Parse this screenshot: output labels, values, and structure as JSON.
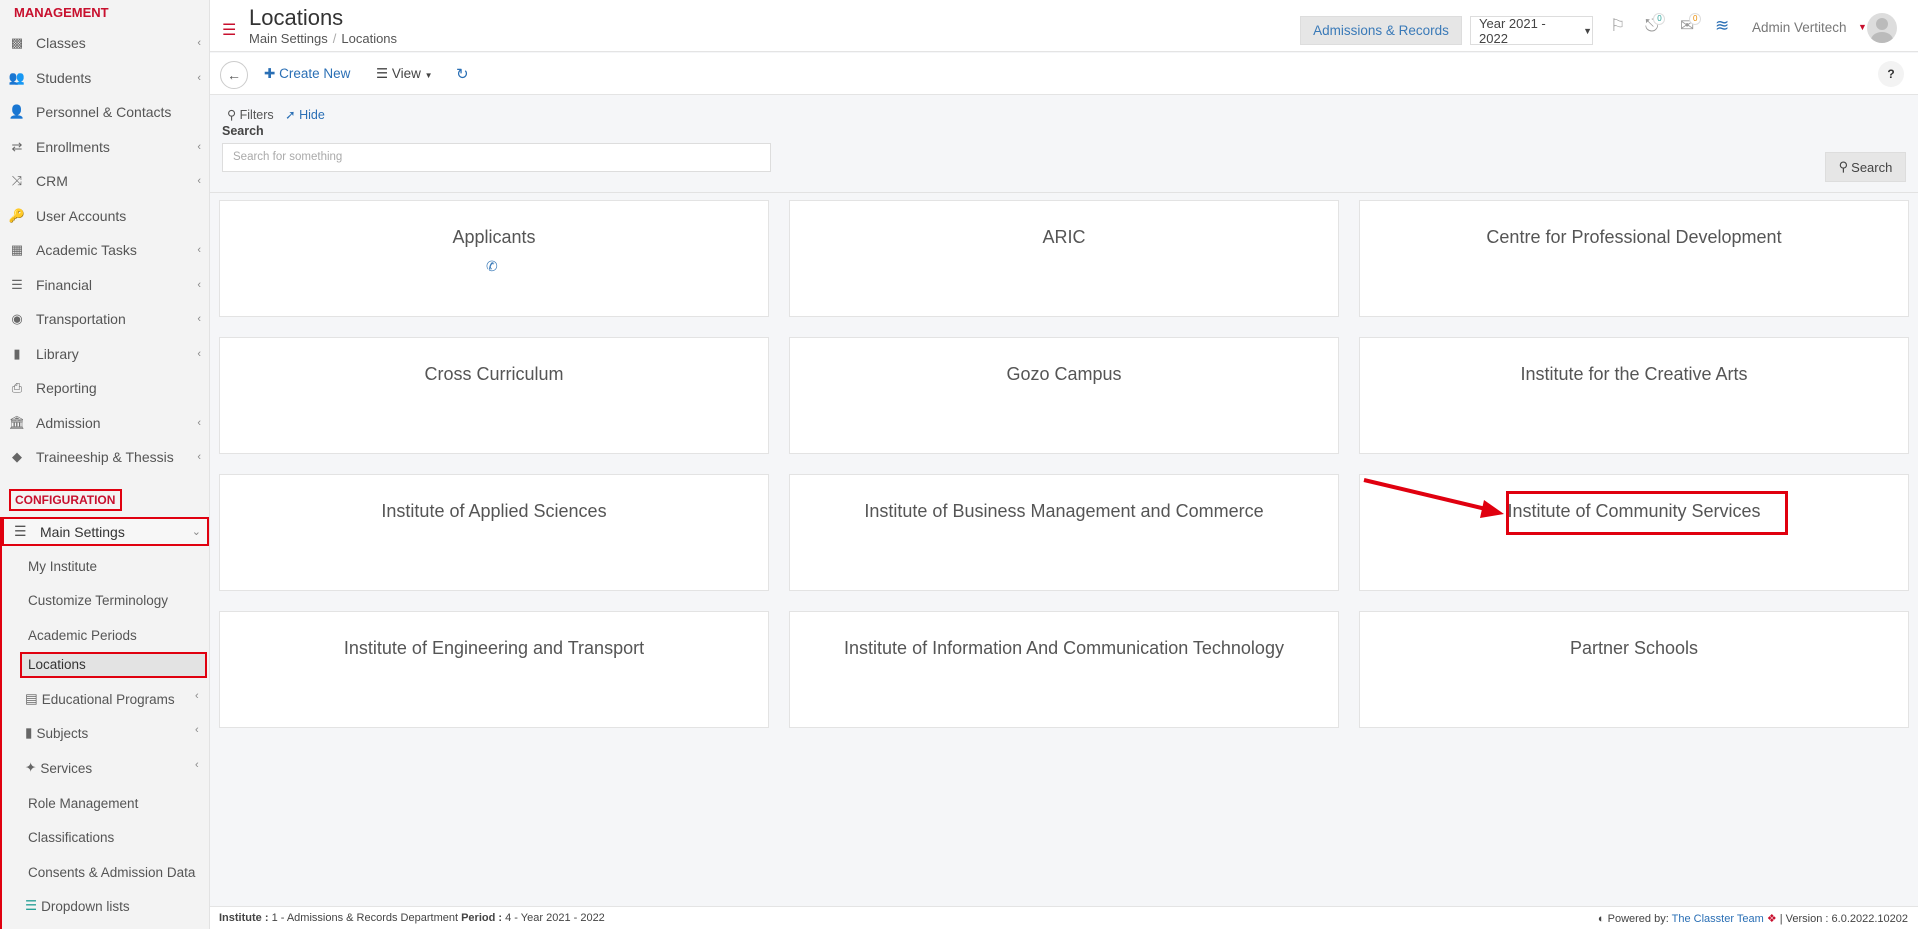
{
  "sidebar": {
    "management_header": "MANAGEMENT",
    "items": [
      {
        "label": "Classes",
        "icon": "classes-icon"
      },
      {
        "label": "Students",
        "icon": "students-icon"
      },
      {
        "label": "Personnel & Contacts",
        "icon": "personnel-icon"
      },
      {
        "label": "Enrollments",
        "icon": "enrollments-icon"
      },
      {
        "label": "CRM",
        "icon": "crm-icon"
      },
      {
        "label": "User Accounts",
        "icon": "key-icon"
      },
      {
        "label": "Academic Tasks",
        "icon": "grid-icon"
      },
      {
        "label": "Financial",
        "icon": "coins-icon"
      },
      {
        "label": "Transportation",
        "icon": "bus-icon"
      },
      {
        "label": "Library",
        "icon": "books-icon"
      },
      {
        "label": "Reporting",
        "icon": "printer-icon"
      },
      {
        "label": "Admission",
        "icon": "institution-icon"
      },
      {
        "label": "Traineeship & Thessis",
        "icon": "cube-icon"
      }
    ],
    "configuration_header": "CONFIGURATION",
    "main_settings": "Main Settings",
    "sub_items": {
      "my_institute": "My Institute",
      "customize_terminology": "Customize Terminology",
      "academic_periods": "Academic Periods",
      "locations": "Locations",
      "educational_programs": "Educational Programs",
      "subjects": "Subjects",
      "services": "Services",
      "role_management": "Role Management",
      "classifications": "Classifications",
      "consents": "Consents & Admission Data",
      "dropdown_lists": "Dropdown lists"
    }
  },
  "header": {
    "title": "Locations",
    "breadcrumb": [
      "Main Settings",
      "Locations"
    ],
    "department": "Admissions & Records",
    "year": "Year 2021 - 2022",
    "notifications_count": "0",
    "messages_count": "0",
    "user": "Admin Vertitech"
  },
  "toolbar": {
    "create_new": "Create New",
    "view": "View",
    "help": "?"
  },
  "filters": {
    "label": "Filters",
    "hide": "Hide",
    "search_label": "Search",
    "search_placeholder": "Search for something",
    "search_button": "Search"
  },
  "locations": [
    "Applicants",
    "ARIC",
    "Centre for Professional Development",
    "Cross Curriculum",
    "Gozo Campus",
    "Institute for the Creative Arts",
    "Institute of Applied Sciences",
    "Institute of Business Management and Commerce",
    "Institute of Community Services",
    "Institute of Engineering and Transport",
    "Institute of Information And Communication Technology",
    "Partner Schools"
  ],
  "footer": {
    "institute_label": "Institute :",
    "institute_value": "1 - Admissions & Records Department",
    "period_label": "Period :",
    "period_value": "4 - Year 2021 - 2022",
    "powered_by": "Powered by:",
    "team": "The Classter Team",
    "version": "| Version : 6.0.2022.10202"
  },
  "colors": {
    "brand_red": "#c8102e",
    "link_blue": "#2a6fb5",
    "annotation_red": "#e0000f"
  }
}
